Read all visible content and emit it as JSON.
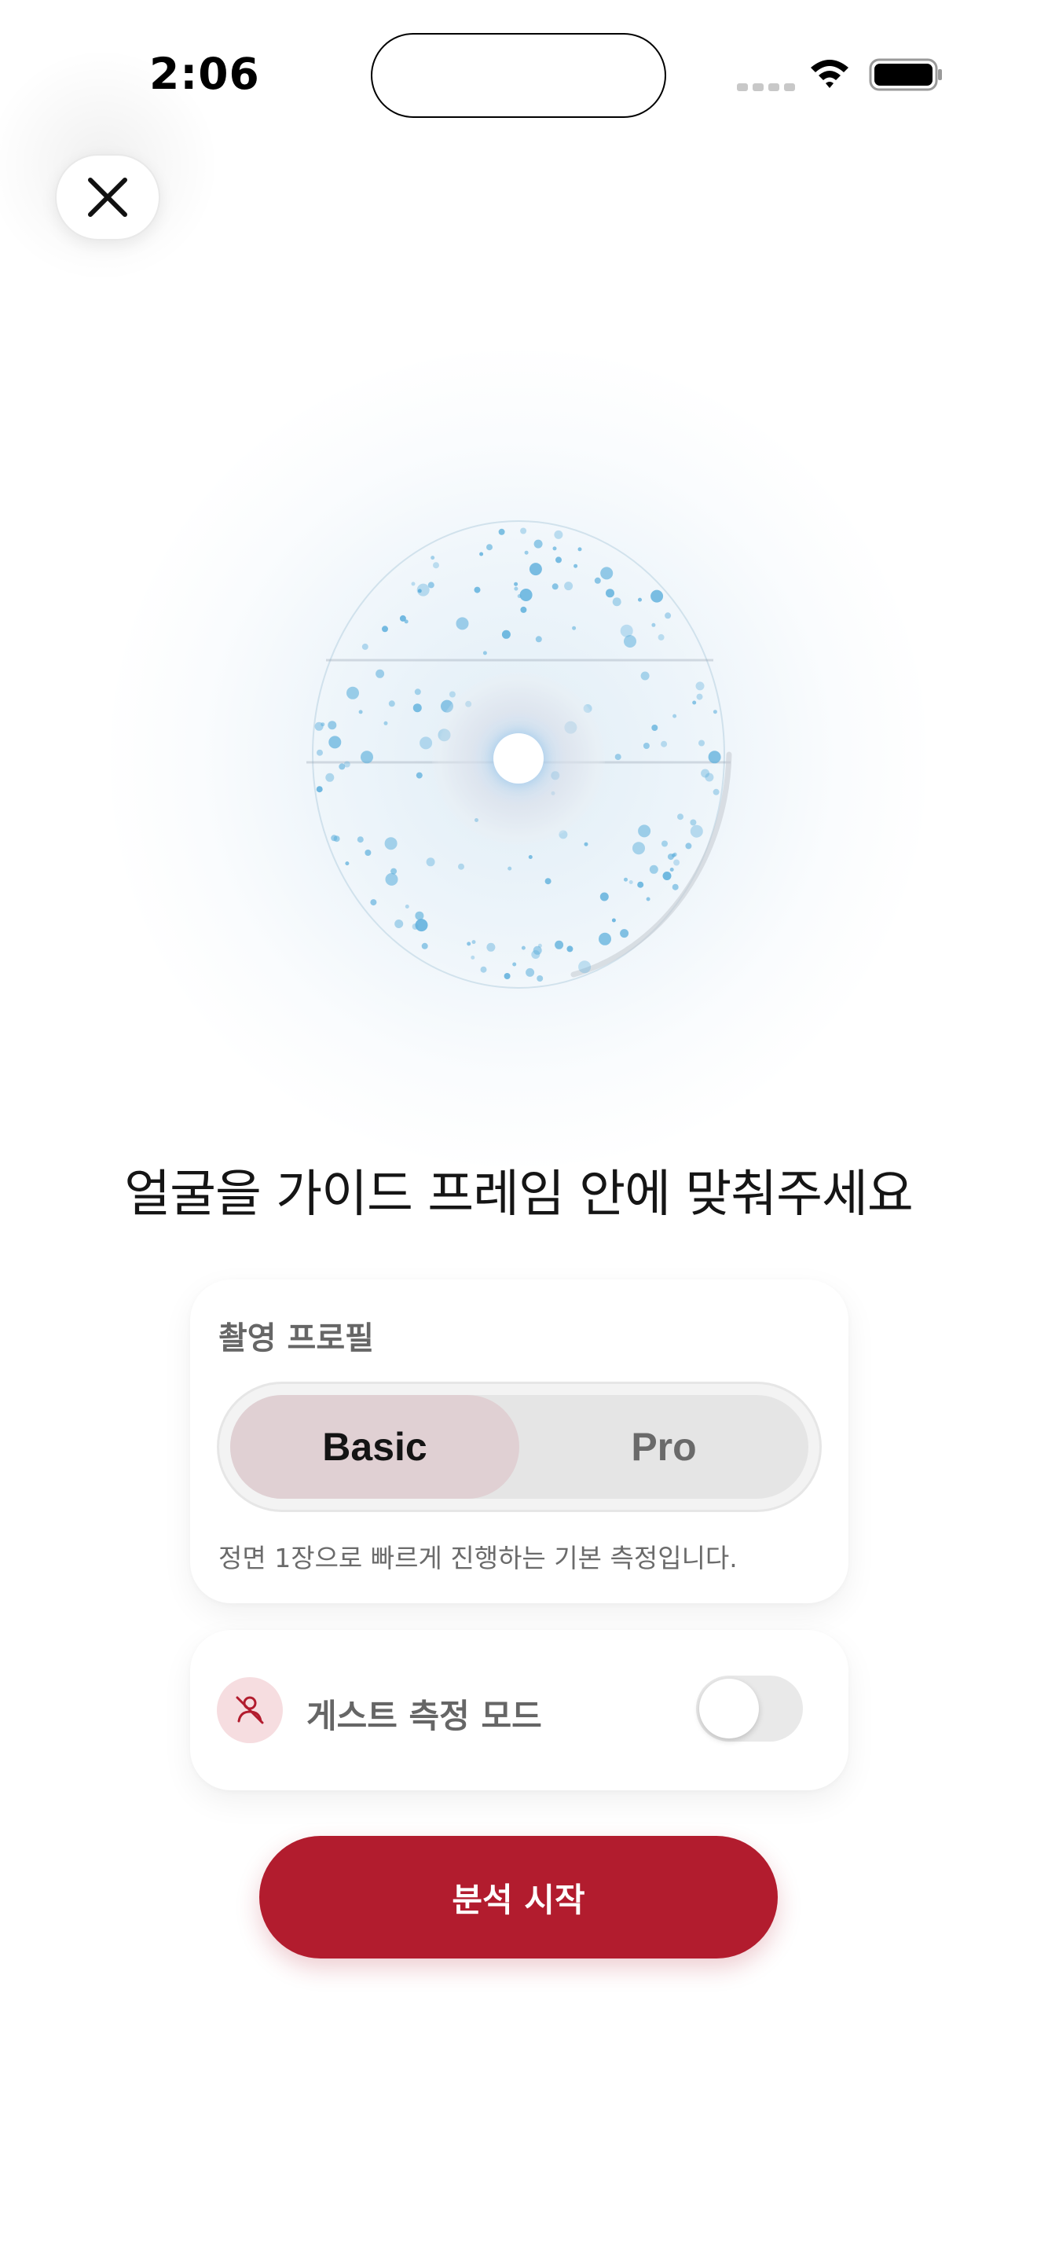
{
  "status_bar": {
    "time": "2:06"
  },
  "icons": {
    "close": "close-icon",
    "wifi": "wifi-icon",
    "battery": "battery-icon",
    "signal": "cellular-signal-icon",
    "guest": "guest-person-off-icon"
  },
  "main": {
    "instruction": "얼굴을 가이드 프레임 안에 맞춰주세요"
  },
  "profile_card": {
    "title": "촬영 프로필",
    "options": [
      "Basic",
      "Pro"
    ],
    "selected": "Basic",
    "description": "정면 1장으로 빠르게 진행하는 기본 측정입니다."
  },
  "guest_card": {
    "label": "게스트 측정 모드",
    "toggle_on": false
  },
  "actions": {
    "start_label": "분석 시작"
  },
  "colors": {
    "accent": "#b21c2e",
    "selected_segment": "#e0d0d3",
    "guest_icon_bg": "#f6dde0",
    "dot_blue": "#5fb0dc"
  }
}
